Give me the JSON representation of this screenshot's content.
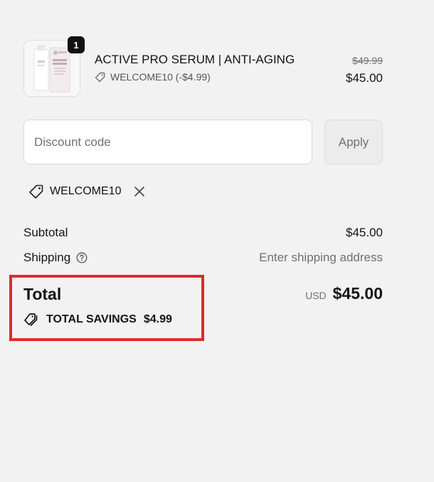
{
  "line_item": {
    "quantity": "1",
    "title": "ACTIVE PRO SERUM | ANTI-AGING",
    "discount_text": "WELCOME10 (-$4.99)",
    "original_price": "$49.99",
    "price": "$45.00",
    "thumbnail_icon": "product-image"
  },
  "discount": {
    "placeholder": "Discount code",
    "value": "",
    "apply_label": "Apply"
  },
  "applied_code": {
    "code": "WELCOME10",
    "tag_icon": "tag-icon",
    "remove_icon": "close-icon"
  },
  "summary": {
    "subtotal_label": "Subtotal",
    "subtotal_value": "$45.00",
    "shipping_label": "Shipping",
    "shipping_value": "Enter shipping address",
    "total_label": "Total",
    "currency": "USD",
    "total_value": "$45.00",
    "savings_label": "TOTAL SAVINGS",
    "savings_value": "$4.99"
  },
  "colors": {
    "background": "#f2f2f2",
    "text": "#141414",
    "muted": "#707070",
    "badge": "#111111",
    "highlight": "#e02b2b"
  }
}
